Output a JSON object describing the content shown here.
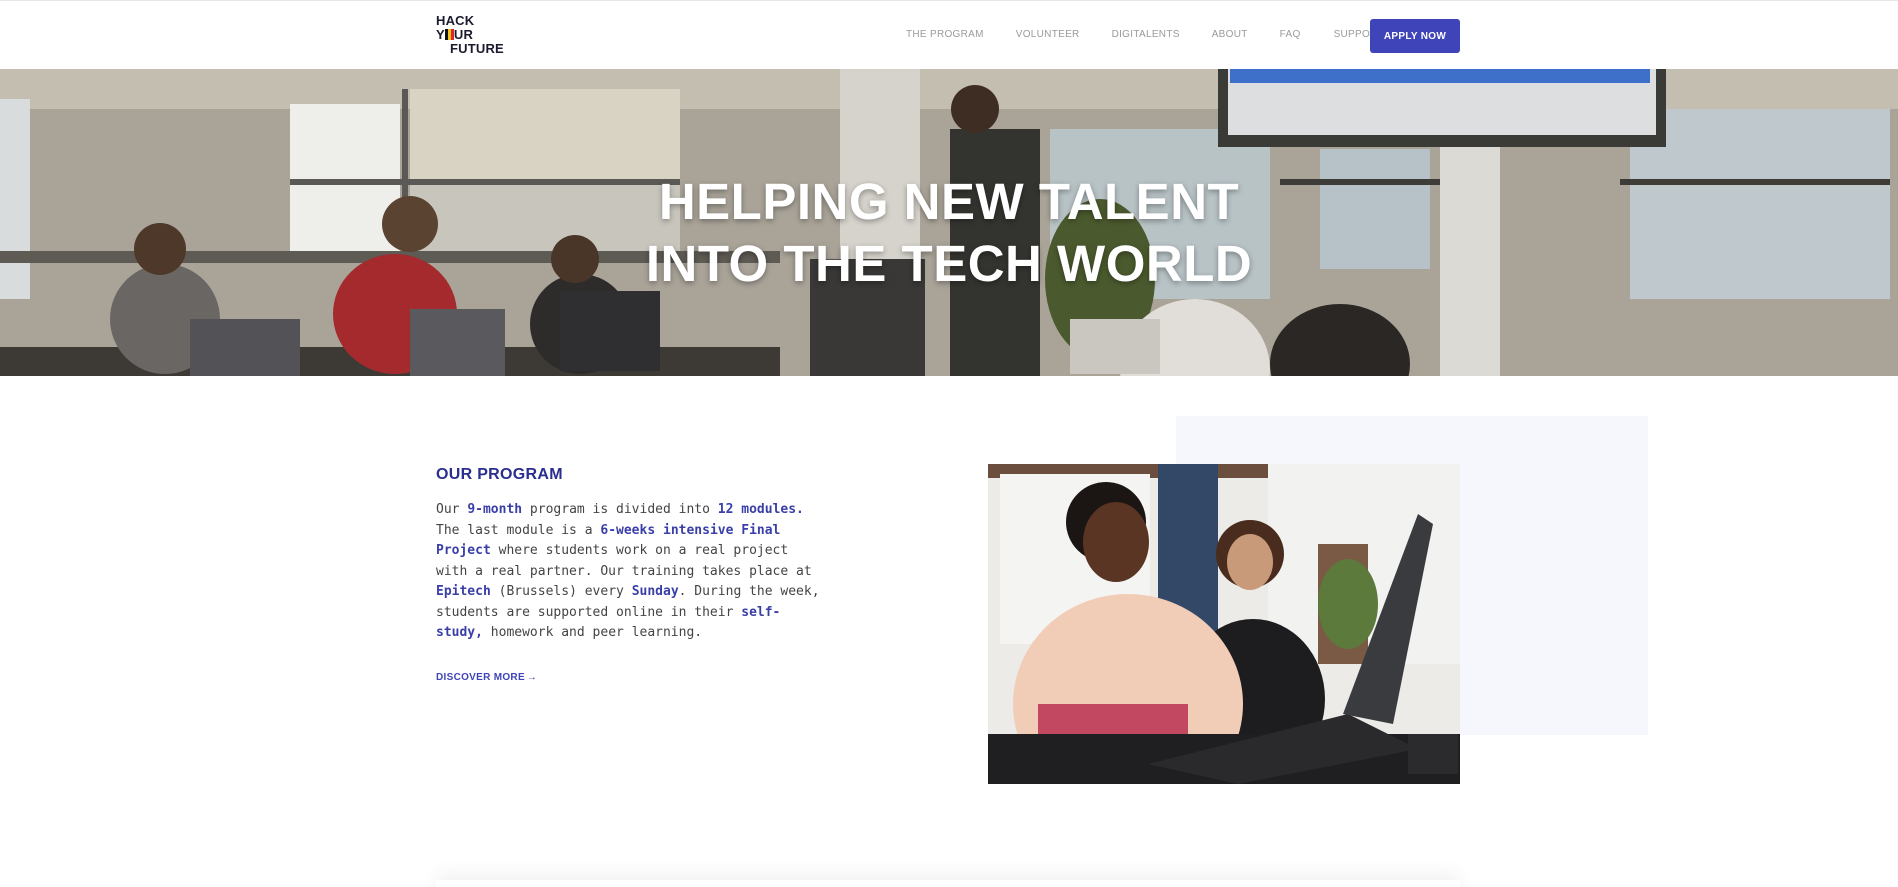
{
  "header": {
    "logo": {
      "line1": "HACK",
      "line2_pre": "Y",
      "line2_post": "UR",
      "line3": "FUTURE",
      "flag_colors": [
        "#111111",
        "#f3c41a",
        "#e0262d"
      ]
    },
    "nav": [
      "THE PROGRAM",
      "VOLUNTEER",
      "DIGITALENTS",
      "ABOUT",
      "FAQ",
      "SUPPORT US"
    ],
    "apply_label": "APPLY NOW",
    "accent_color": "#3f44b9"
  },
  "hero": {
    "title_line1": "HELPING NEW TALENT",
    "title_line2": "INTO THE TECH WORLD"
  },
  "program": {
    "title": "OUR PROGRAM",
    "segments": [
      {
        "text": "Our ",
        "highlight": false
      },
      {
        "text": "9-month",
        "highlight": true
      },
      {
        "text": " program is divided into ",
        "highlight": false
      },
      {
        "text": "12 modules.",
        "highlight": true
      },
      {
        "text": " The last module is a ",
        "highlight": false
      },
      {
        "text": "6-weeks intensive Final Project",
        "highlight": true
      },
      {
        "text": " where students work on a real project with a real partner. Our training takes place at ",
        "highlight": false
      },
      {
        "text": "Epitech",
        "highlight": true
      },
      {
        "text": " (Brussels) every ",
        "highlight": false
      },
      {
        "text": "Sunday",
        "highlight": true
      },
      {
        "text": ". During the week, students are supported online in their ",
        "highlight": false
      },
      {
        "text": "self-study,",
        "highlight": true
      },
      {
        "text": " homework and peer learning.",
        "highlight": false
      }
    ],
    "discover_label": "DISCOVER MORE",
    "discover_icon": "arrow-right-icon"
  }
}
